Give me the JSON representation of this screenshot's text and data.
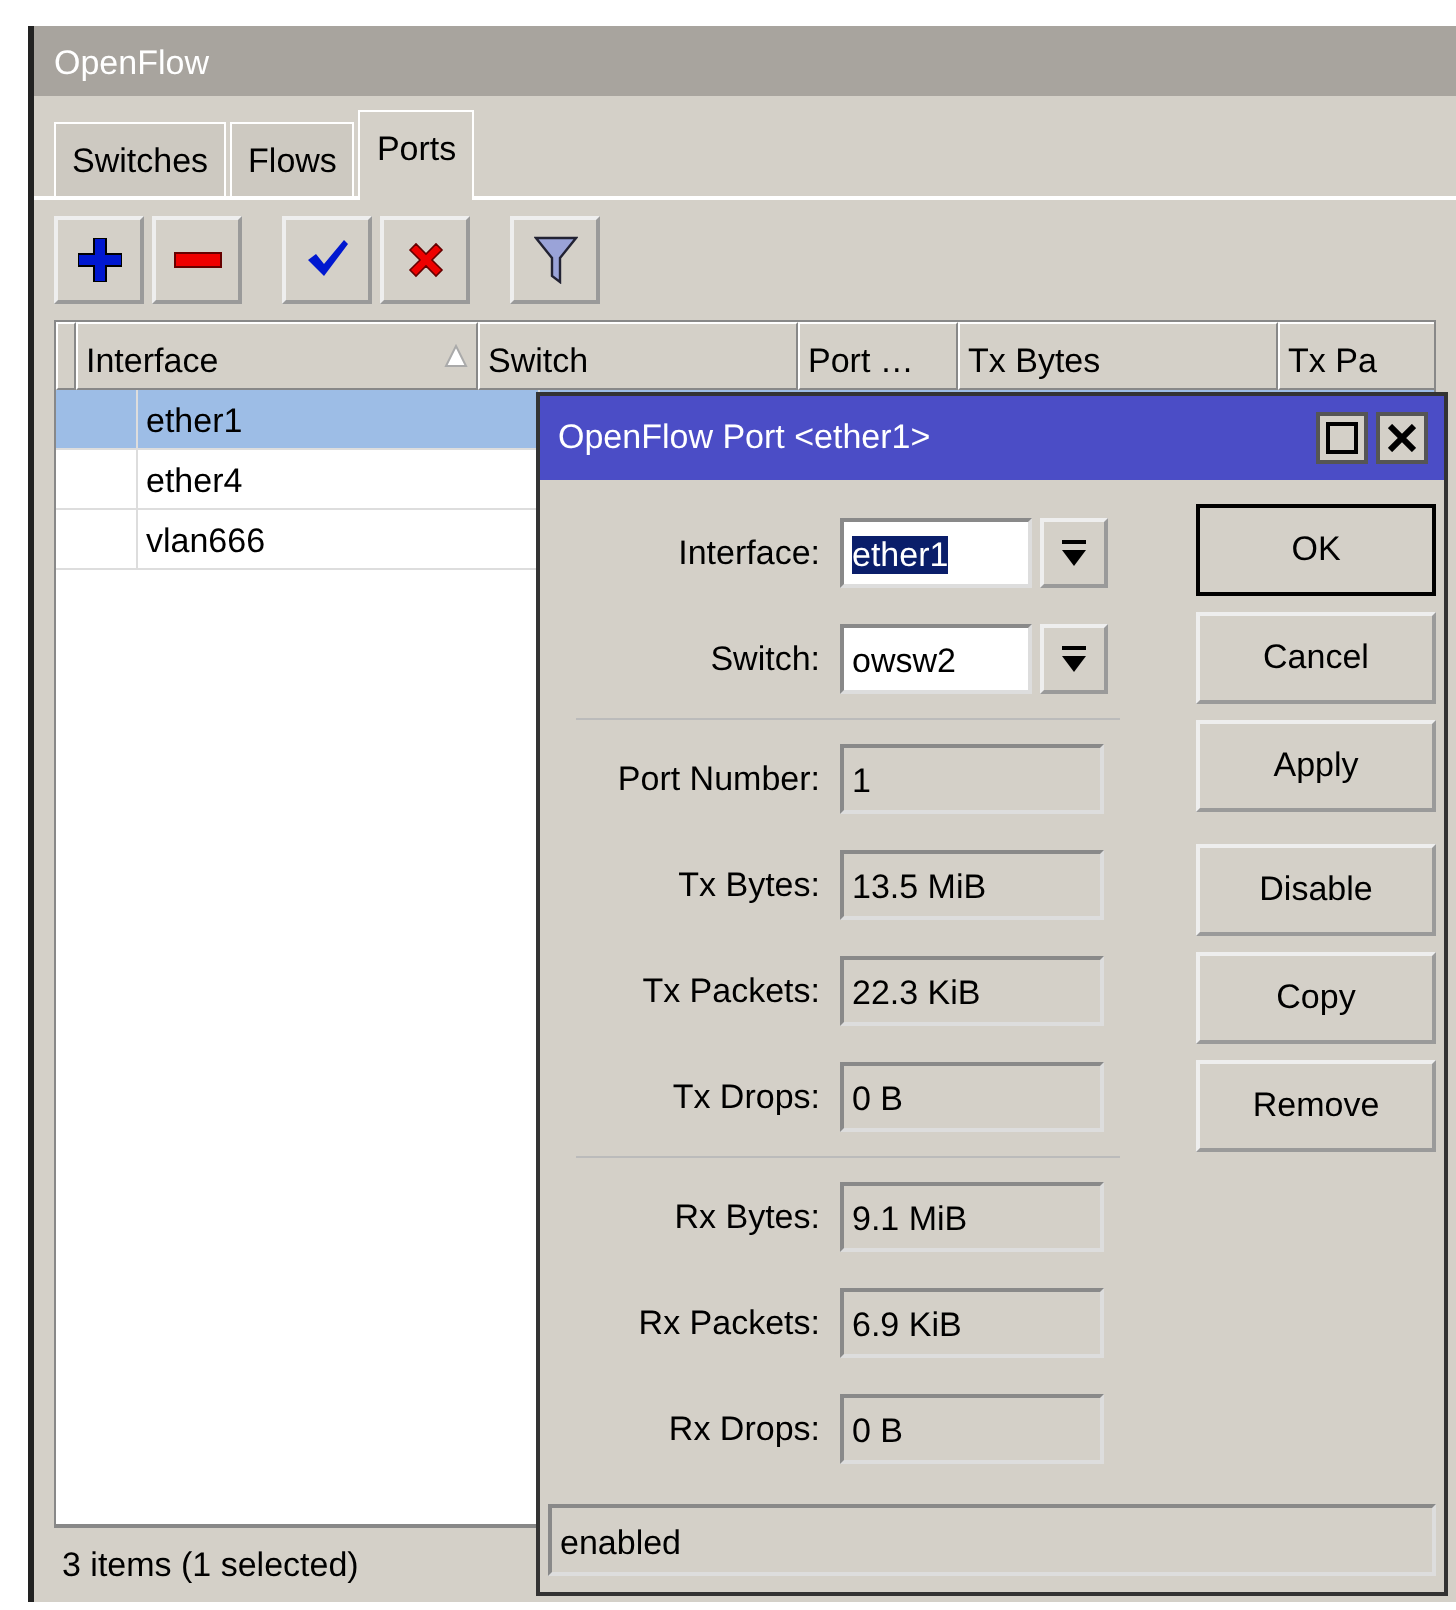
{
  "window": {
    "title": "OpenFlow"
  },
  "tabs": [
    {
      "label": "Switches",
      "selected": false
    },
    {
      "label": "Flows",
      "selected": false
    },
    {
      "label": "Ports",
      "selected": true
    }
  ],
  "table": {
    "columns": [
      {
        "label": "Interface",
        "sorted": true
      },
      {
        "label": "Switch",
        "sorted": false
      },
      {
        "label": "Port …",
        "sorted": false
      },
      {
        "label": "Tx Bytes",
        "sorted": false
      },
      {
        "label": "Tx Pa",
        "sorted": false
      }
    ],
    "rows": [
      {
        "interface": "ether1",
        "selected": true
      },
      {
        "interface": "ether4",
        "selected": false
      },
      {
        "interface": "vlan666",
        "selected": false
      }
    ]
  },
  "status_bar": "3 items (1 selected)",
  "dialog": {
    "title": "OpenFlow Port <ether1>",
    "sections": [
      [
        {
          "label": "Interface:",
          "value": "ether1",
          "kind": "dropdown",
          "focused": true
        },
        {
          "label": "Switch:",
          "value": "owsw2",
          "kind": "dropdown",
          "focused": false
        }
      ],
      [
        {
          "label": "Port Number:",
          "value": "1",
          "kind": "readonly"
        },
        {
          "label": "Tx Bytes:",
          "value": "13.5 MiB",
          "kind": "readonly"
        },
        {
          "label": "Tx Packets:",
          "value": "22.3 KiB",
          "kind": "readonly"
        },
        {
          "label": "Tx Drops:",
          "value": "0 B",
          "kind": "readonly"
        }
      ],
      [
        {
          "label": "Rx Bytes:",
          "value": "9.1 MiB",
          "kind": "readonly"
        },
        {
          "label": "Rx Packets:",
          "value": "6.9 KiB",
          "kind": "readonly"
        },
        {
          "label": "Rx Drops:",
          "value": "0 B",
          "kind": "readonly"
        }
      ]
    ],
    "buttons": [
      {
        "label": "OK",
        "default": true
      },
      {
        "label": "Cancel",
        "default": false
      },
      {
        "label": "Apply",
        "default": false
      },
      {
        "label": "Disable",
        "default": false
      },
      {
        "label": "Copy",
        "default": false
      },
      {
        "label": "Remove",
        "default": false
      }
    ],
    "status": "enabled"
  }
}
